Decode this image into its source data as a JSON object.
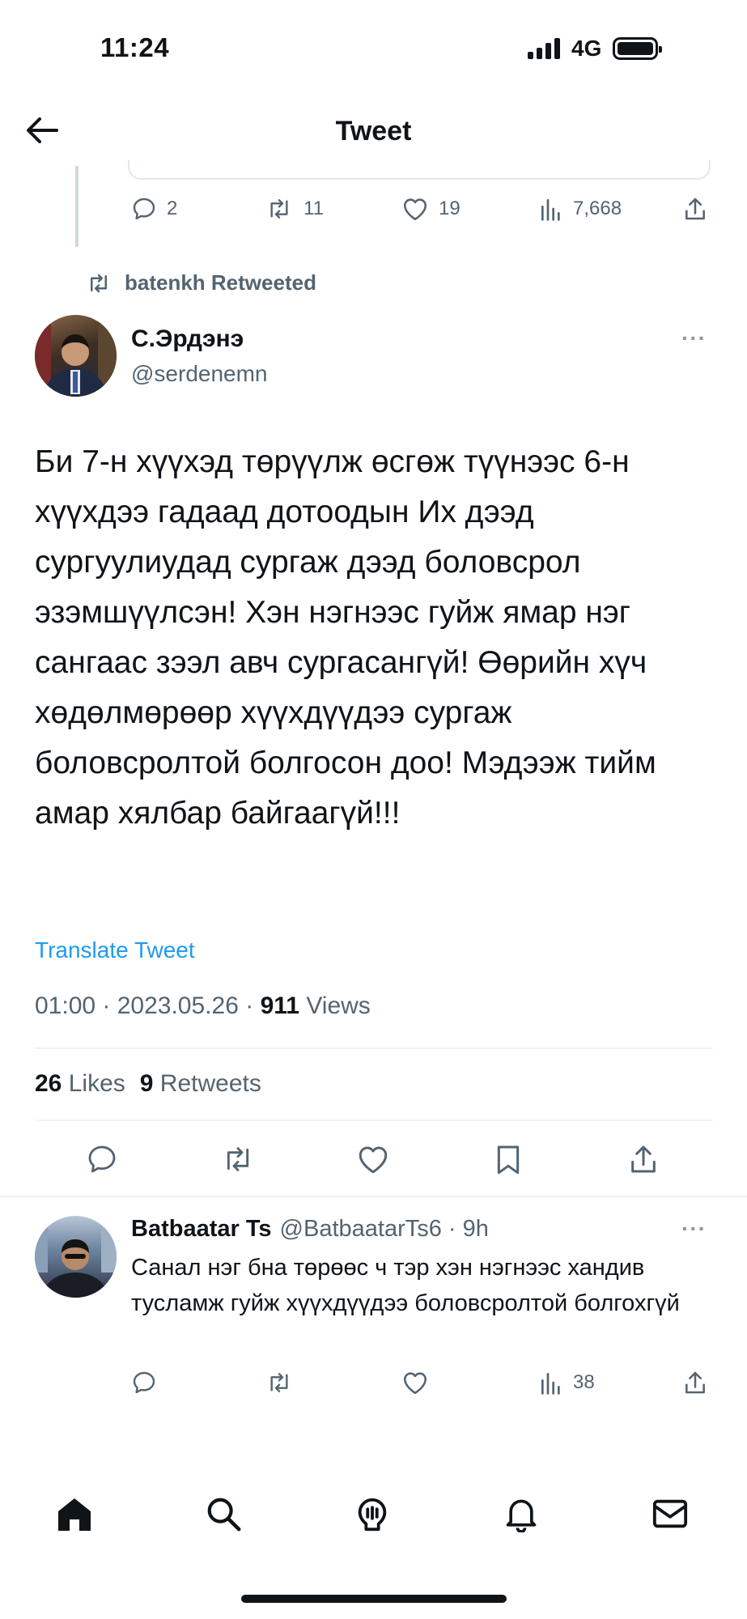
{
  "status_bar": {
    "time": "11:24",
    "network": "4G"
  },
  "nav": {
    "title": "Tweet"
  },
  "previous_tweet": {
    "actions": {
      "replies": "2",
      "retweets": "11",
      "likes": "19",
      "views": "7,668"
    }
  },
  "retweet_banner": "batenkh Retweeted",
  "tweet": {
    "author_name": "С.Эрдэнэ",
    "author_handle": "@serdenemn",
    "text": "Би 7-н хүүхэд төрүүлж өсгөж түүнээс 6-н хүүхдээ гадаад дотоодын Их дээд сургуулиудад сургаж дээд боловсрол эзэмшүүлсэн! Хэн нэгнээс гуйж ямар нэг сангаас зээл авч сургасангүй! Өөрийн хүч хөдөлмөрөөр хүүхдүүдээ сургаж боловсролтой болгосон доо! Мэдээж тийм амар хялбар байгаагүй!!!",
    "translate_label": "Translate Tweet",
    "timestamp": "01:00 · 2023.05.26 ·",
    "views_count": "911",
    "views_label": "Views",
    "likes_count": "26",
    "likes_label": "Likes",
    "retweets_count": "9",
    "retweets_label": "Retweets"
  },
  "reply": {
    "name": "Batbaatar Ts",
    "handle_time": "@BatbaatarTs6 · 9h",
    "text": "Санал нэг бна төрөөс ч тэр хэн нэгнээс хандив тусламж гуйж хүүхдүүдээ боловсролтой болгохгүй",
    "views": "38"
  },
  "more_glyph": "···",
  "colors": {
    "accent": "#1d9bf0",
    "secondary_text": "#536471",
    "primary_text": "#0f1419"
  },
  "icons": {
    "back": "arrow-left-icon",
    "reply": "speech-bubble-icon",
    "retweet": "retweet-arrows-icon",
    "like": "heart-icon",
    "views": "bar-chart-icon",
    "share": "share-upload-icon",
    "bookmark": "bookmark-icon",
    "home": "home-icon",
    "search": "search-icon",
    "spaces": "microphone-icon",
    "notifications": "bell-icon",
    "messages": "envelope-icon"
  }
}
